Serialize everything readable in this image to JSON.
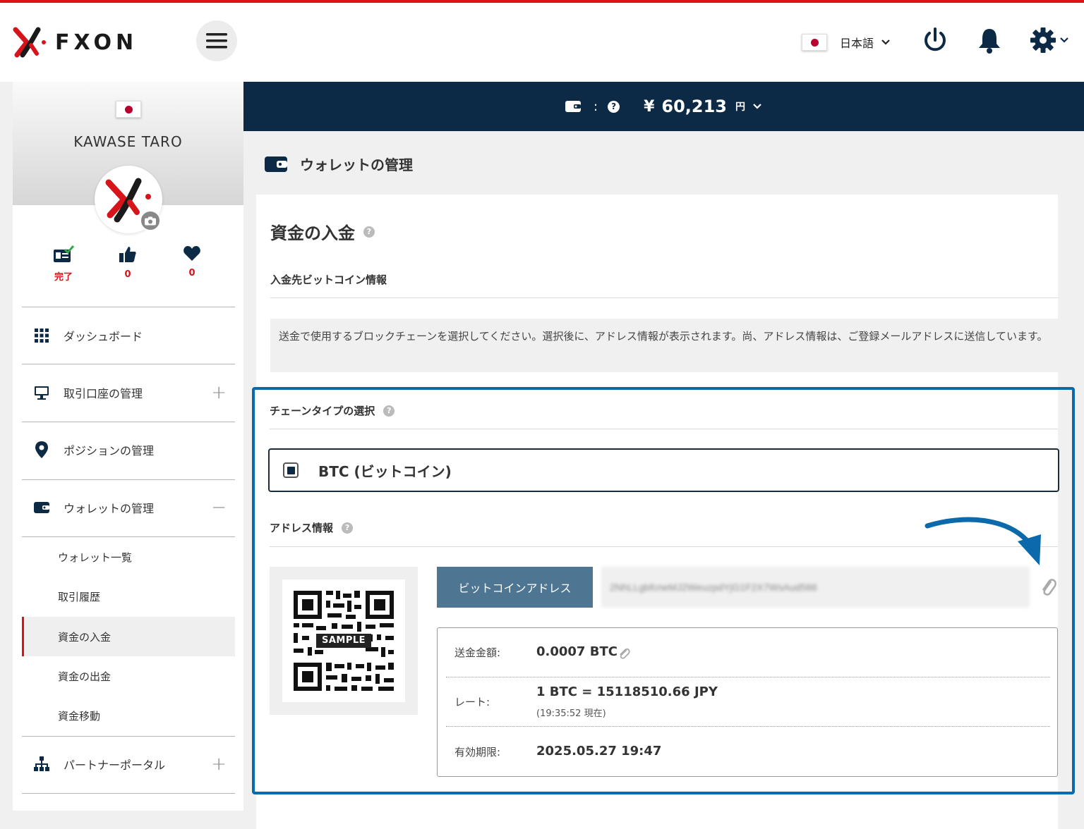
{
  "header": {
    "logo_text": "FXON",
    "language": "日本語"
  },
  "balance": {
    "separator": ":",
    "currency_symbol": "¥",
    "amount": "60,213",
    "unit": "円"
  },
  "profile": {
    "name": "KAWASE TARO",
    "stats": [
      {
        "icon": "id-card-check-icon",
        "value": "完了"
      },
      {
        "icon": "thumbs-up-icon",
        "value": "0"
      },
      {
        "icon": "heart-icon",
        "value": "0"
      }
    ]
  },
  "sidebar": {
    "items": [
      {
        "label": "ダッシュボード",
        "icon": "grid-icon"
      },
      {
        "label": "取引口座の管理",
        "icon": "monitor-icon",
        "toggle": "+"
      },
      {
        "label": "ポジションの管理",
        "icon": "map-pin-icon"
      },
      {
        "label": "ウォレットの管理",
        "icon": "wallet-icon",
        "toggle": "−"
      },
      {
        "label": "パートナーポータル",
        "icon": "org-chart-icon",
        "toggle": "+"
      }
    ],
    "sub_items": [
      {
        "label": "ウォレット一覧"
      },
      {
        "label": "取引履歴"
      },
      {
        "label": "資金の入金",
        "active": true
      },
      {
        "label": "資金の出金"
      },
      {
        "label": "資金移動"
      }
    ]
  },
  "main": {
    "page_title": "ウォレットの管理",
    "section_title": "資金の入金",
    "bitcoin_info_label": "入金先ビットコイン情報",
    "info_text": "送金で使用するブロックチェーンを選択してください。選択後に、アドレス情報が表示されます。尚、アドレス情報は、ご登録メールアドレスに送信しています。",
    "chain_type_label": "チェーンタイプの選択",
    "chain_option": "BTC (ビットコイン)",
    "address_info_label": "アドレス情報",
    "qr_sample_label": "SAMPLE",
    "address_button": "ビットコインアドレス",
    "address_value": "2NhLLgbfcneMJ2WeuzpdYjG1F2X7WsAud566",
    "details": {
      "amount_label": "送金金額:",
      "amount_value": "0.0007 BTC",
      "rate_label": "レート:",
      "rate_value": "1 BTC = 15118510.66 JPY",
      "rate_time": "(19:35:52 現在)",
      "expiry_label": "有効期限:",
      "expiry_value": "2025.05.27 19:47"
    }
  },
  "colors": {
    "brand_red": "#d7141a",
    "navy": "#0c2a45",
    "highlight_blue": "#0a6aab",
    "button_blue": "#4e7592"
  }
}
